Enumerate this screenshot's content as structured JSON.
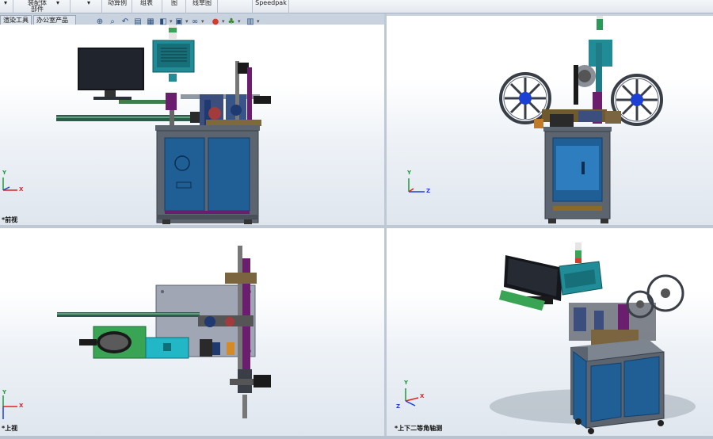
{
  "ribbon": {
    "items": [
      {
        "id": "assembly",
        "line1": "装配体",
        "line2": "部件"
      },
      {
        "id": "mold",
        "line1": "",
        "line2": "动算例"
      },
      {
        "id": "table",
        "line1": "",
        "line2": "组表"
      },
      {
        "id": "sketch",
        "line1": "",
        "line2": "图"
      },
      {
        "id": "explode",
        "line1": "",
        "line2": "线草图"
      },
      {
        "id": "speedpak",
        "line1": "Speedpak",
        "line2": ""
      }
    ]
  },
  "tabs": [
    "渲染工具",
    "办公室产品"
  ],
  "views": {
    "front": "*前视",
    "right": "",
    "top": "*上视",
    "iso": "*上下二等角轴测"
  },
  "triad": {
    "x": "X",
    "y": "Y",
    "z": "Z"
  },
  "colors": {
    "frame": "#5c6470",
    "panel": "#1f5f96",
    "panel_dark": "#123f6b",
    "accent_purple": "#6b1e6e",
    "monitor": "#14161b",
    "teal_box": "#1f8c97",
    "green": "#2a9a5a"
  }
}
